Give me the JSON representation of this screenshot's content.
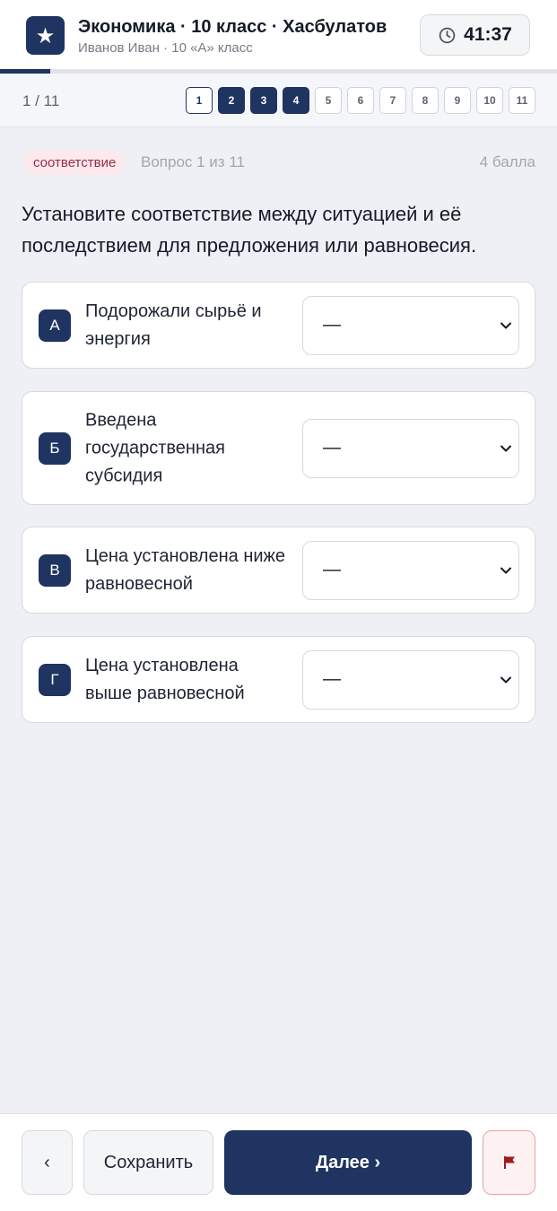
{
  "header": {
    "logo_glyph": "★",
    "title": "Экономика · 10 класс · Хасбулатов",
    "subtitle": "Иванов Иван · 10 «А» класс",
    "timer": "41:37"
  },
  "progress": {
    "fraction": 0.09
  },
  "question_nav": {
    "counter": "1 / 11",
    "items": [
      {
        "label": "1",
        "state": "current"
      },
      {
        "label": "2",
        "state": "answered"
      },
      {
        "label": "3",
        "state": "answered"
      },
      {
        "label": "4",
        "state": "answered"
      },
      {
        "label": "5",
        "state": "empty"
      },
      {
        "label": "6",
        "state": "empty"
      },
      {
        "label": "7",
        "state": "empty"
      },
      {
        "label": "8",
        "state": "empty"
      },
      {
        "label": "9",
        "state": "empty"
      },
      {
        "label": "10",
        "state": "empty"
      },
      {
        "label": "11",
        "state": "empty"
      }
    ]
  },
  "question": {
    "type": "соответствие",
    "of": "Вопрос 1 из 11",
    "points": "4 балла",
    "text": "Установите соответствие между ситуацией и её последствием для предложения или равновесия.",
    "rows": [
      {
        "letter": "А",
        "text": "Подорожали сырьё и энергия",
        "value": "—"
      },
      {
        "letter": "Б",
        "text": "Введена государственная субсидия",
        "value": "—"
      },
      {
        "letter": "В",
        "text": "Цена установлена ниже равновесной",
        "value": "—"
      },
      {
        "letter": "Г",
        "text": "Цена установлена выше равновесной",
        "value": "—"
      }
    ]
  },
  "footer": {
    "back": "‹",
    "save": "Сохранить",
    "next": "Далее ›",
    "flag_icon": "flag-icon"
  },
  "colors": {
    "primary": "#1f3461",
    "badge_bg": "#fbe9ee",
    "badge_text": "#9c2c48",
    "flag": "#9b1c1c"
  }
}
